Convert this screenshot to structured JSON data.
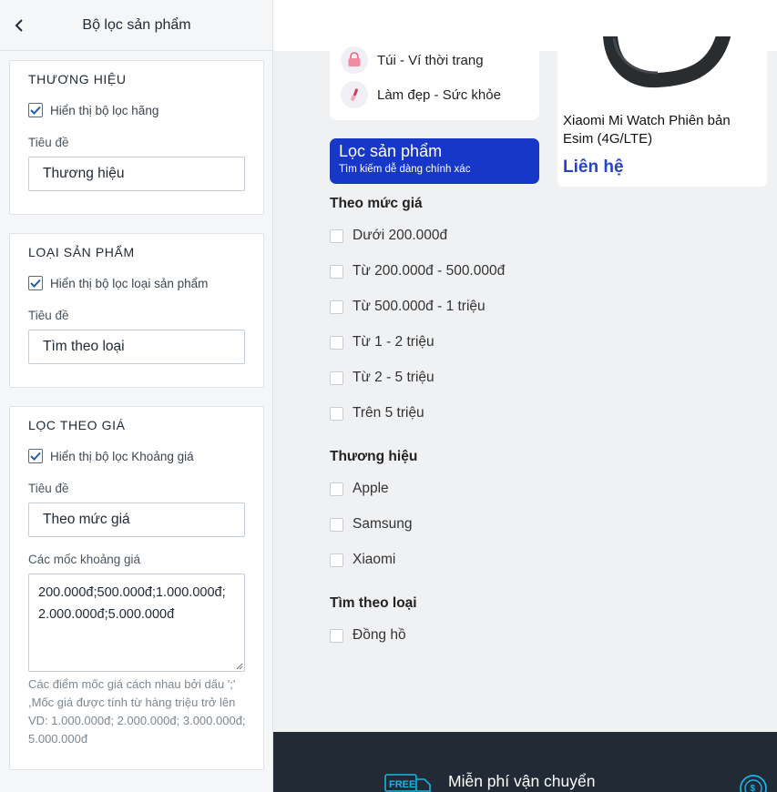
{
  "editor": {
    "title": "Bộ lọc sản phẩm",
    "brand": {
      "heading": "THƯƠNG HIỆU",
      "checkbox_label": "Hiển thị bộ lọc hãng",
      "field_label": "Tiêu đề",
      "field_value": "Thương hiệu"
    },
    "type": {
      "heading": "LOẠI SẢN PHẨM",
      "checkbox_label": "Hiển thị bộ lọc loại sản phẩm",
      "field_label": "Tiêu đề",
      "field_value": "Tìm theo loại"
    },
    "price": {
      "heading": "LỌC THEO GIÁ",
      "checkbox_label": "Hiển thị bộ lọc Khoảng giá",
      "field_label": "Tiêu đề",
      "field_value": "Theo mức giá",
      "ranges_label": "Các mốc khoảng giá",
      "ranges_value": "200.000đ;500.000đ;1.000.000đ;2.000.000đ;5.000.000đ",
      "help": "Các điểm mốc giá cách nhau bởi dấu ';' ,Mốc giá được tính từ hàng triệu trở lên VD: 1.000.000đ; 2.000.000đ; 3.000.000đ; 5.000.000đ"
    }
  },
  "preview": {
    "categories": [
      {
        "label": "Túi - Ví thời trang",
        "icon": "handbag-icon"
      },
      {
        "label": "Làm đẹp - Sức khỏe",
        "icon": "lipstick-icon"
      }
    ],
    "product": {
      "name": "Xiaomi Mi Watch Phiên bản Esim (4G/LTE)",
      "price": "Liên hệ"
    },
    "filter_banner": {
      "title": "Lọc sản phẩm",
      "subtitle": "Tìm kiếm dễ dàng chính xác"
    },
    "price_section": {
      "title": "Theo mức giá",
      "options": [
        "Dưới 200.000đ",
        "Từ 200.000đ - 500.000đ",
        "Từ 500.000đ - 1 triệu",
        "Từ 1 - 2 triệu",
        "Từ 2 - 5 triệu",
        "Trên 5 triệu"
      ]
    },
    "brand_section": {
      "title": "Thương hiệu",
      "options": [
        "Apple",
        "Samsung",
        "Xiaomi"
      ]
    },
    "type_section": {
      "title": "Tìm theo loại",
      "options": [
        "Đồng hồ"
      ]
    },
    "footer": {
      "shipping_text": "Miễn phí vận chuyển",
      "free_badge": "FREE"
    }
  },
  "colors": {
    "accent": "#1637c8",
    "price": "#2543c6",
    "checkbox": "#1f5ea8",
    "footer": "#222b35",
    "footer_icon": "#1ab3e6"
  }
}
